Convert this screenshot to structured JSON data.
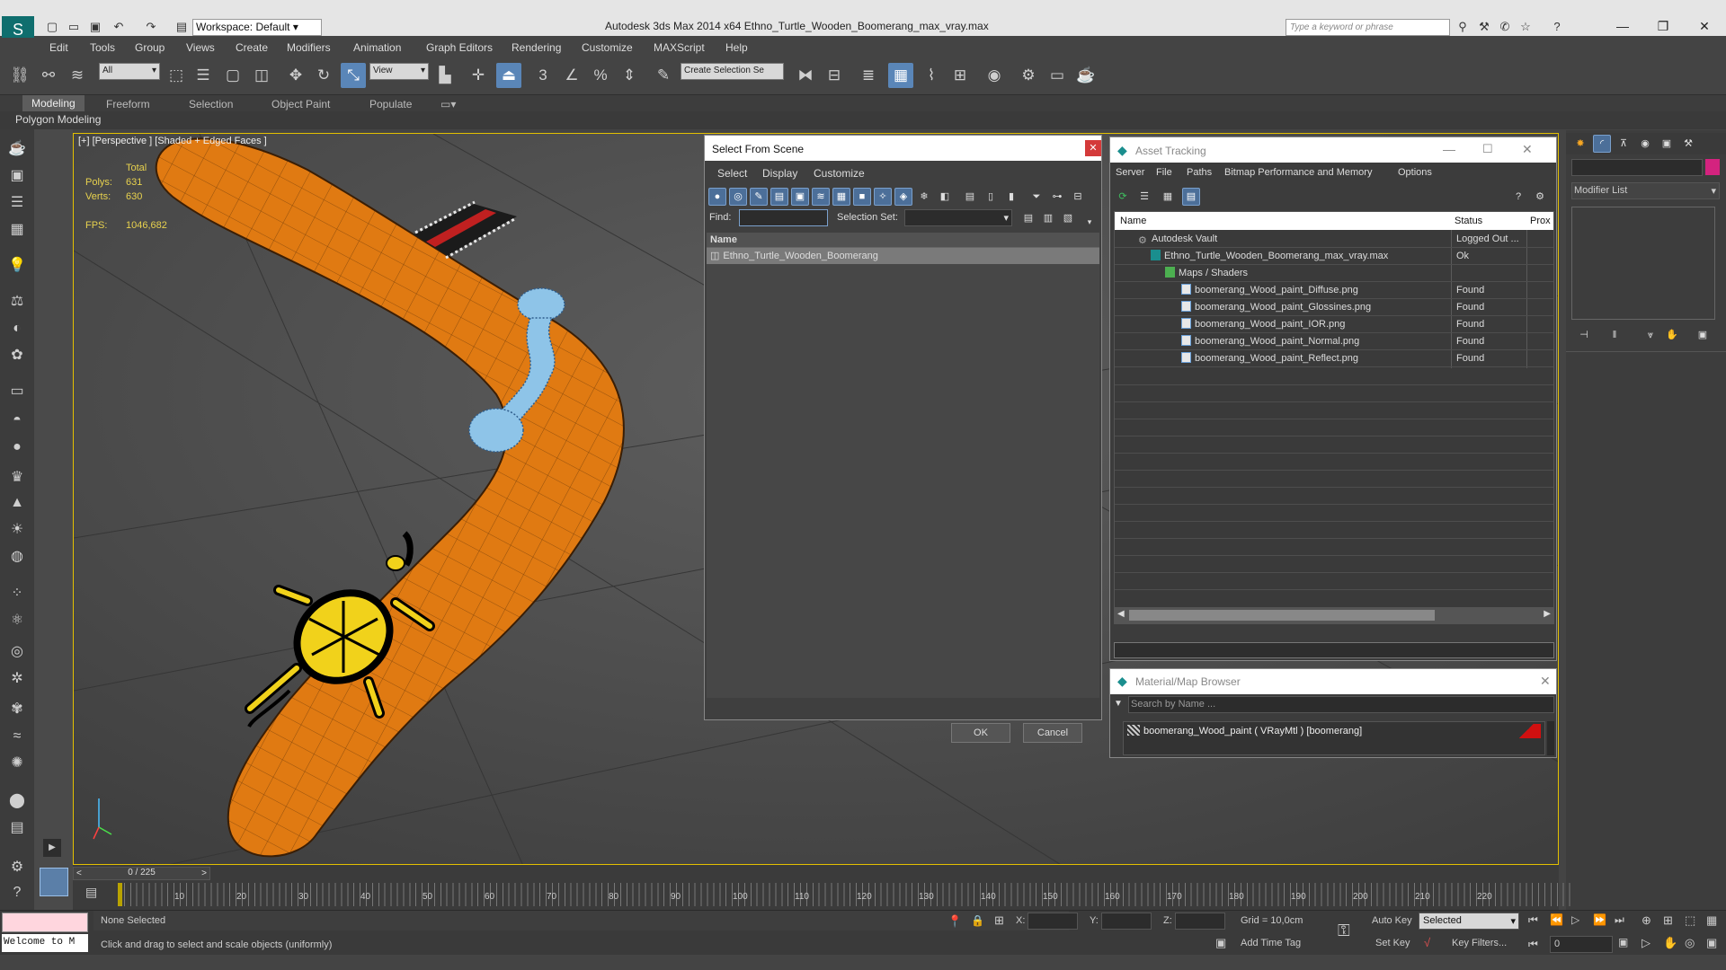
{
  "app": {
    "title": "Autodesk 3ds Max  2014 x64    Ethno_Turtle_Wooden_Boomerang_max_vray.max",
    "workspace": "Workspace: Default",
    "search_placeholder": "Type a keyword or phrase"
  },
  "menu": [
    "Edit",
    "Tools",
    "Group",
    "Views",
    "Create",
    "Modifiers",
    "Animation",
    "Graph Editors",
    "Rendering",
    "Customize",
    "MAXScript",
    "Help"
  ],
  "toolbar": {
    "filter_value": "All",
    "coord_value": "View",
    "selection_set_placeholder": "Create Selection Se"
  },
  "ribbon": {
    "tabs": [
      "Modeling",
      "Freeform",
      "Selection",
      "Object Paint",
      "Populate"
    ],
    "sub": "Polygon Modeling"
  },
  "viewport": {
    "label": "[+] [Perspective ] [Shaded + Edged Faces ]",
    "stats": {
      "total_label": "Total",
      "polys_label": "Polys:",
      "polys": "631",
      "verts_label": "Verts:",
      "verts": "630",
      "fps_label": "FPS:",
      "fps": "1046,682"
    },
    "colors": {
      "wood": "#e07a12",
      "paint_blue": "#8ec4e8",
      "turtle_yellow": "#f1d21b"
    }
  },
  "select_from_scene": {
    "title": "Select From Scene",
    "menu": [
      "Select",
      "Display",
      "Customize"
    ],
    "find_label": "Find:",
    "selection_set_label": "Selection Set:",
    "column_name": "Name",
    "items": [
      "Ethno_Turtle_Wooden_Boomerang"
    ],
    "ok": "OK",
    "cancel": "Cancel"
  },
  "asset_tracking": {
    "title": "Asset Tracking",
    "menu": [
      "Server",
      "File",
      "Paths",
      "Bitmap Performance and Memory",
      "Options"
    ],
    "col_name": "Name",
    "col_status": "Status",
    "col_proxy": "Prox",
    "rows": [
      {
        "name": "Autodesk Vault",
        "status": "Logged Out ..."
      },
      {
        "name": "Ethno_Turtle_Wooden_Boomerang_max_vray.max",
        "status": "Ok"
      },
      {
        "name": "Maps / Shaders",
        "status": ""
      },
      {
        "name": "boomerang_Wood_paint_Diffuse.png",
        "status": "Found"
      },
      {
        "name": "boomerang_Wood_paint_Glossines.png",
        "status": "Found"
      },
      {
        "name": "boomerang_Wood_paint_IOR.png",
        "status": "Found"
      },
      {
        "name": "boomerang_Wood_paint_Normal.png",
        "status": "Found"
      },
      {
        "name": "boomerang_Wood_paint_Reflect.png",
        "status": "Found"
      }
    ]
  },
  "material_browser": {
    "title": "Material/Map Browser",
    "search_placeholder": "Search by Name ...",
    "item": "boomerang_Wood_paint ( VRayMtl ) [boomerang]"
  },
  "command_panel": {
    "modifier_list": "Modifier List"
  },
  "timeline": {
    "frame": "0 / 225",
    "ticks": [
      "10",
      "20",
      "30",
      "40",
      "50",
      "60",
      "70",
      "80",
      "90",
      "100",
      "110",
      "120",
      "130",
      "140",
      "150",
      "160",
      "170",
      "180",
      "190",
      "200",
      "210",
      "220"
    ]
  },
  "status": {
    "maxscript": "Welcome to M",
    "selection": "None Selected",
    "prompt": "Click and drag to select and scale objects (uniformly)",
    "x_label": "X:",
    "y_label": "Y:",
    "z_label": "Z:",
    "grid": "Grid = 10,0cm",
    "add_time_tag": "Add Time Tag",
    "auto_key": "Auto Key",
    "set_key": "Set Key",
    "selected": "Selected",
    "key_filters": "Key Filters...",
    "frame_value": "0"
  }
}
